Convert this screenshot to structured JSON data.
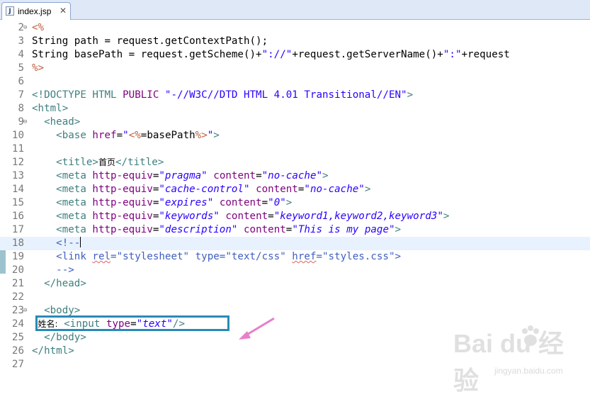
{
  "tab": {
    "icon": "jsp-file-icon",
    "label": "index.jsp",
    "close": "✕"
  },
  "highlight_color": "#2a8ab7",
  "arrow_color": "#e87fc8",
  "lines": [
    {
      "num": "2",
      "fold": "⊖",
      "tokens": [
        [
          "jsp",
          "<%"
        ]
      ]
    },
    {
      "num": "3",
      "fold": "",
      "tokens": [
        [
          "plain",
          "String path = request.getContextPath();"
        ]
      ]
    },
    {
      "num": "4",
      "fold": "",
      "tokens": [
        [
          "plain",
          "String basePath = request.getScheme()+"
        ],
        [
          "str",
          "\"://\""
        ],
        [
          "plain",
          "+request.getServerName()+"
        ],
        [
          "str",
          "\":\""
        ],
        [
          "plain",
          "+request"
        ]
      ]
    },
    {
      "num": "5",
      "fold": "",
      "tokens": [
        [
          "jsp",
          "%>"
        ]
      ]
    },
    {
      "num": "6",
      "fold": "",
      "tokens": []
    },
    {
      "num": "7",
      "fold": "",
      "tokens": [
        [
          "tag",
          "<!DOCTYPE HTML "
        ],
        [
          "attr",
          "PUBLIC "
        ],
        [
          "str",
          "\"-//W3C//DTD HTML 4.01 Transitional//EN\""
        ],
        [
          "tag",
          ">"
        ]
      ]
    },
    {
      "num": "8",
      "fold": "",
      "tokens": [
        [
          "tag",
          "<html>"
        ]
      ]
    },
    {
      "num": "9",
      "fold": "⊖",
      "tokens": [
        [
          "plain",
          "  "
        ],
        [
          "tag",
          "<head>"
        ]
      ]
    },
    {
      "num": "10",
      "fold": "",
      "tokens": [
        [
          "plain",
          "    "
        ],
        [
          "tag",
          "<base "
        ],
        [
          "attr",
          "href"
        ],
        [
          "plain",
          "="
        ],
        [
          "str",
          "\""
        ],
        [
          "jsp",
          "<%"
        ],
        [
          "plain",
          "=basePath"
        ],
        [
          "jsp",
          "%>"
        ],
        [
          "str",
          "\""
        ],
        [
          "tag",
          ">"
        ]
      ]
    },
    {
      "num": "11",
      "fold": "",
      "tokens": []
    },
    {
      "num": "12",
      "fold": "",
      "tokens": [
        [
          "plain",
          "    "
        ],
        [
          "tag",
          "<title>"
        ],
        [
          "cjk",
          "首页"
        ],
        [
          "tag",
          "</title>"
        ]
      ]
    },
    {
      "num": "13",
      "fold": "",
      "tokens": [
        [
          "plain",
          "    "
        ],
        [
          "tag",
          "<meta "
        ],
        [
          "attr",
          "http-equiv"
        ],
        [
          "plain",
          "="
        ],
        [
          "istr",
          "\"pragma\""
        ],
        [
          "plain",
          " "
        ],
        [
          "attr",
          "content"
        ],
        [
          "plain",
          "="
        ],
        [
          "istr",
          "\"no-cache\""
        ],
        [
          "tag",
          ">"
        ]
      ]
    },
    {
      "num": "14",
      "fold": "",
      "tokens": [
        [
          "plain",
          "    "
        ],
        [
          "tag",
          "<meta "
        ],
        [
          "attr",
          "http-equiv"
        ],
        [
          "plain",
          "="
        ],
        [
          "istr",
          "\"cache-control\""
        ],
        [
          "plain",
          " "
        ],
        [
          "attr",
          "content"
        ],
        [
          "plain",
          "="
        ],
        [
          "istr",
          "\"no-cache\""
        ],
        [
          "tag",
          ">"
        ]
      ]
    },
    {
      "num": "15",
      "fold": "",
      "tokens": [
        [
          "plain",
          "    "
        ],
        [
          "tag",
          "<meta "
        ],
        [
          "attr",
          "http-equiv"
        ],
        [
          "plain",
          "="
        ],
        [
          "istr",
          "\"expires\""
        ],
        [
          "plain",
          " "
        ],
        [
          "attr",
          "content"
        ],
        [
          "plain",
          "="
        ],
        [
          "istr",
          "\"0\""
        ],
        [
          "tag",
          ">"
        ]
      ]
    },
    {
      "num": "16",
      "fold": "",
      "tokens": [
        [
          "plain",
          "    "
        ],
        [
          "tag",
          "<meta "
        ],
        [
          "attr",
          "http-equiv"
        ],
        [
          "plain",
          "="
        ],
        [
          "istr",
          "\"keywords\""
        ],
        [
          "plain",
          " "
        ],
        [
          "attr",
          "content"
        ],
        [
          "plain",
          "="
        ],
        [
          "istr",
          "\"keyword1,keyword2,keyword3\""
        ],
        [
          "tag",
          ">"
        ]
      ]
    },
    {
      "num": "17",
      "fold": "",
      "tokens": [
        [
          "plain",
          "    "
        ],
        [
          "tag",
          "<meta "
        ],
        [
          "attr",
          "http-equiv"
        ],
        [
          "plain",
          "="
        ],
        [
          "istr",
          "\"description\""
        ],
        [
          "plain",
          " "
        ],
        [
          "attr",
          "content"
        ],
        [
          "plain",
          "="
        ],
        [
          "istr",
          "\"This is my page\""
        ],
        [
          "tag",
          ">"
        ]
      ]
    },
    {
      "num": "18",
      "fold": "",
      "current": true,
      "caret": true,
      "tokens": [
        [
          "plain",
          "    "
        ],
        [
          "cmt",
          "<!--"
        ]
      ]
    },
    {
      "num": "19",
      "fold": "",
      "tokens": [
        [
          "plain",
          "    "
        ],
        [
          "cmt",
          "<link "
        ],
        [
          "cmtsq",
          "rel"
        ],
        [
          "cmt",
          "=\"stylesheet\" type=\"text/css\" "
        ],
        [
          "cmtsq",
          "href"
        ],
        [
          "cmt",
          "=\"styles.css\">"
        ]
      ]
    },
    {
      "num": "20",
      "fold": "",
      "tokens": [
        [
          "plain",
          "    "
        ],
        [
          "cmt",
          "-->"
        ]
      ]
    },
    {
      "num": "21",
      "fold": "",
      "tokens": [
        [
          "plain",
          "  "
        ],
        [
          "tag",
          "</head>"
        ]
      ]
    },
    {
      "num": "22",
      "fold": "",
      "tokens": []
    },
    {
      "num": "23",
      "fold": "⊖",
      "tokens": [
        [
          "plain",
          "  "
        ],
        [
          "tag",
          "<body>"
        ]
      ]
    },
    {
      "num": "24",
      "fold": "",
      "tokens": [
        [
          "plain",
          " "
        ],
        [
          "cjk",
          "姓名:"
        ],
        [
          "plain",
          " "
        ],
        [
          "tag",
          "<input "
        ],
        [
          "attr",
          "type"
        ],
        [
          "plain",
          "="
        ],
        [
          "istr",
          "\"text\""
        ],
        [
          "tag",
          "/>"
        ]
      ]
    },
    {
      "num": "25",
      "fold": "",
      "tokens": [
        [
          "plain",
          "  "
        ],
        [
          "tag",
          "</body>"
        ]
      ]
    },
    {
      "num": "26",
      "fold": "",
      "tokens": [
        [
          "tag",
          "</html>"
        ]
      ]
    },
    {
      "num": "27",
      "fold": "",
      "tokens": []
    }
  ],
  "watermark": {
    "main": "Bai du 经验",
    "sub": "jingyan.baidu.com"
  }
}
